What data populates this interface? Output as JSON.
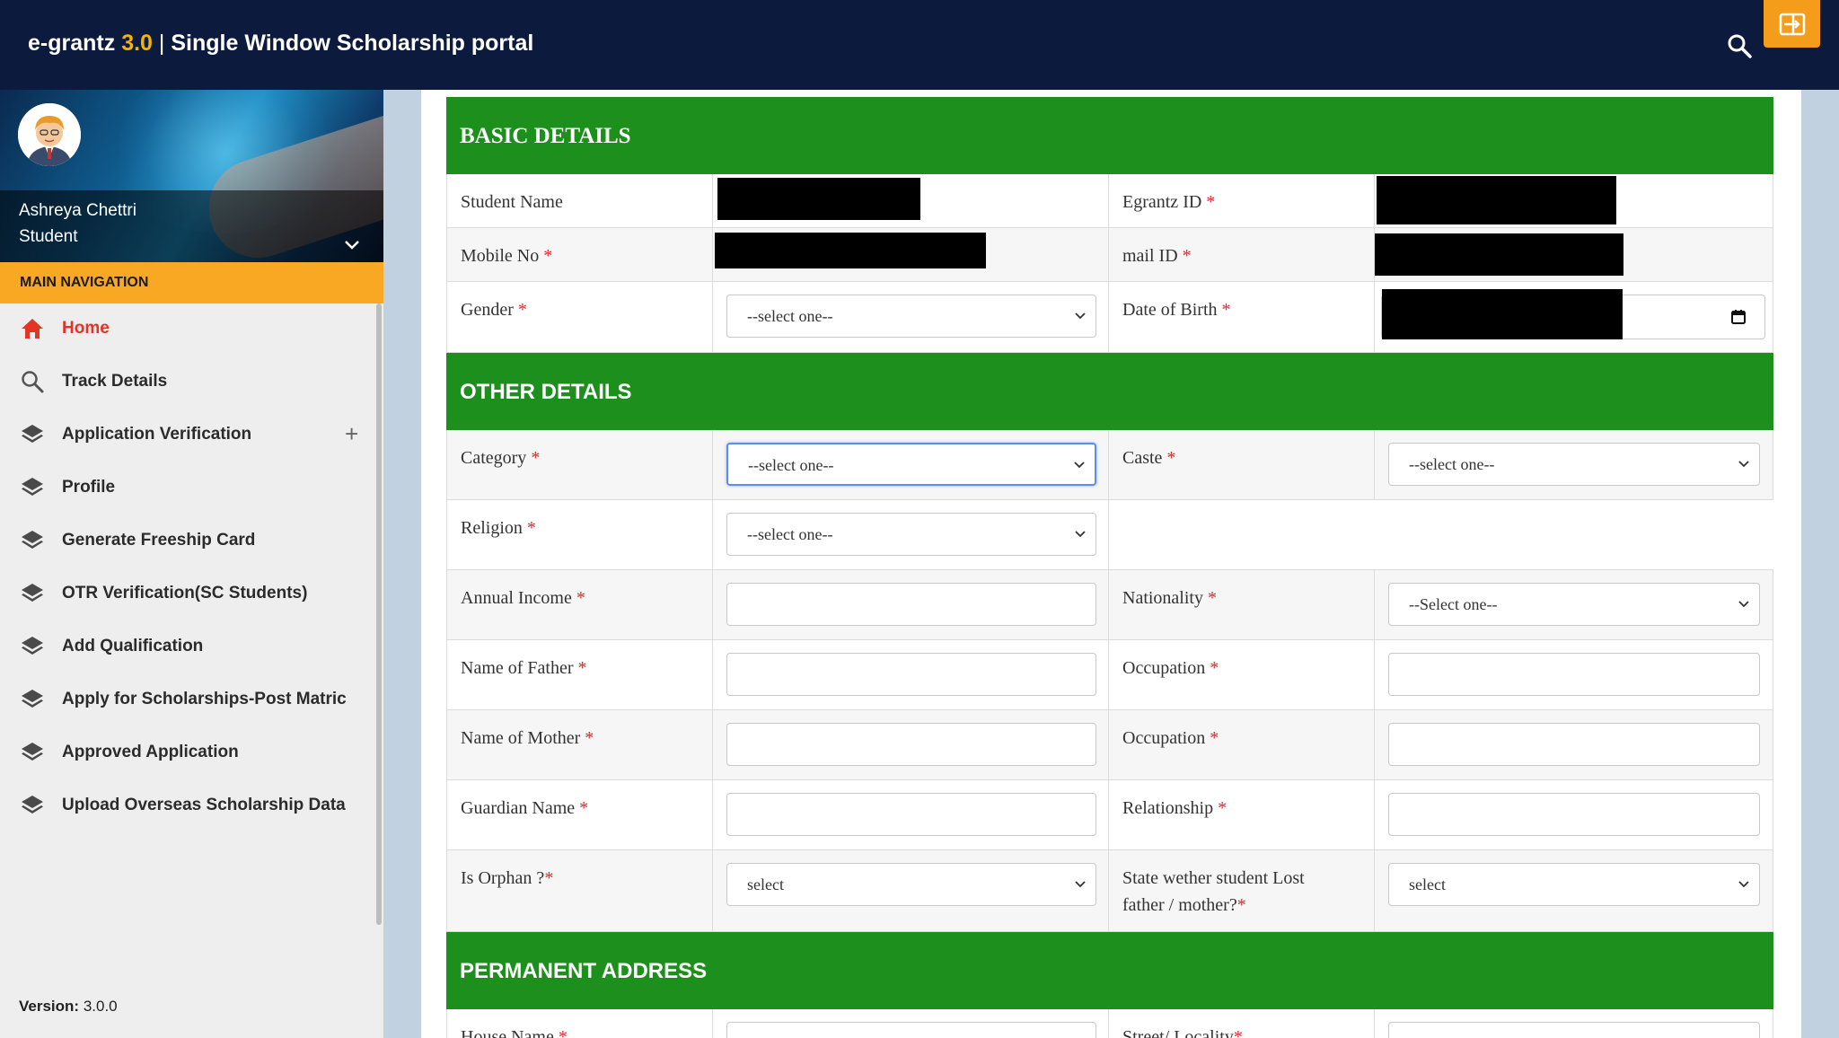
{
  "header": {
    "brand_name": "e-grantz",
    "brand_version": "3.0",
    "brand_separator": "|",
    "brand_subtitle": "Single Window Scholarship portal",
    "icons": {
      "search": "search-icon",
      "logout": "logout-icon"
    }
  },
  "user": {
    "name": "Ashreya Chettri",
    "role": "Student"
  },
  "sidebar": {
    "nav_header": "MAIN NAVIGATION",
    "items": [
      {
        "label": "Home",
        "icon": "home-icon",
        "active": true
      },
      {
        "label": "Track Details",
        "icon": "search-icon"
      },
      {
        "label": "Application Verification",
        "icon": "layers-icon",
        "expandable": true
      },
      {
        "label": "Profile",
        "icon": "layers-icon"
      },
      {
        "label": "Generate Freeship Card",
        "icon": "layers-icon"
      },
      {
        "label": "OTR Verification(SC Students)",
        "icon": "layers-icon"
      },
      {
        "label": "Add Qualification",
        "icon": "layers-icon"
      },
      {
        "label": "Apply for Scholarships-Post Matric",
        "icon": "layers-icon"
      },
      {
        "label": "Approved Application",
        "icon": "layers-icon"
      },
      {
        "label": "Upload Overseas Scholarship Data",
        "icon": "layers-icon"
      }
    ],
    "expand_symbol": "+",
    "version_label": "Version:",
    "version_value": "3.0.0"
  },
  "colors": {
    "header_bg": "#0b1a3d",
    "accent": "#f4b400",
    "section_green": "#1d8f1d",
    "nav_active": "#e53325",
    "required": "#e0262b"
  },
  "basic_details": {
    "title": "BASIC DETAILS",
    "student_name_label": "Student Name",
    "egrantz_id_label": "Egrantz ID",
    "mobile_label": "Mobile No",
    "mail_label": "mail ID",
    "gender_label": "Gender",
    "gender_value": "--select one--",
    "dob_label": "Date of Birth"
  },
  "other_details": {
    "title": "OTHER DETAILS",
    "category_label": "Category",
    "category_value": "--select one--",
    "caste_label": "Caste",
    "caste_value": "--select one--",
    "religion_label": "Religion",
    "religion_value": "--select one--",
    "income_label": "Annual Income",
    "nationality_label": "Nationality",
    "nationality_value": "--Select one--",
    "father_label": "Name of Father",
    "father_occupation_label": "Occupation",
    "mother_label": "Name of Mother",
    "mother_occupation_label": "Occupation",
    "guardian_label": "Guardian Name",
    "relationship_label": "Relationship",
    "orphan_label": "Is Orphan ?",
    "orphan_value": "select",
    "lost_parent_label_1": "State wether student Lost",
    "lost_parent_label_2": "father / mother?",
    "lost_parent_value": "select"
  },
  "permanent_address": {
    "title": "PERMANENT ADDRESS",
    "house_label": "House Name",
    "street_label": "Street/ Locality"
  },
  "required_mark": "*"
}
